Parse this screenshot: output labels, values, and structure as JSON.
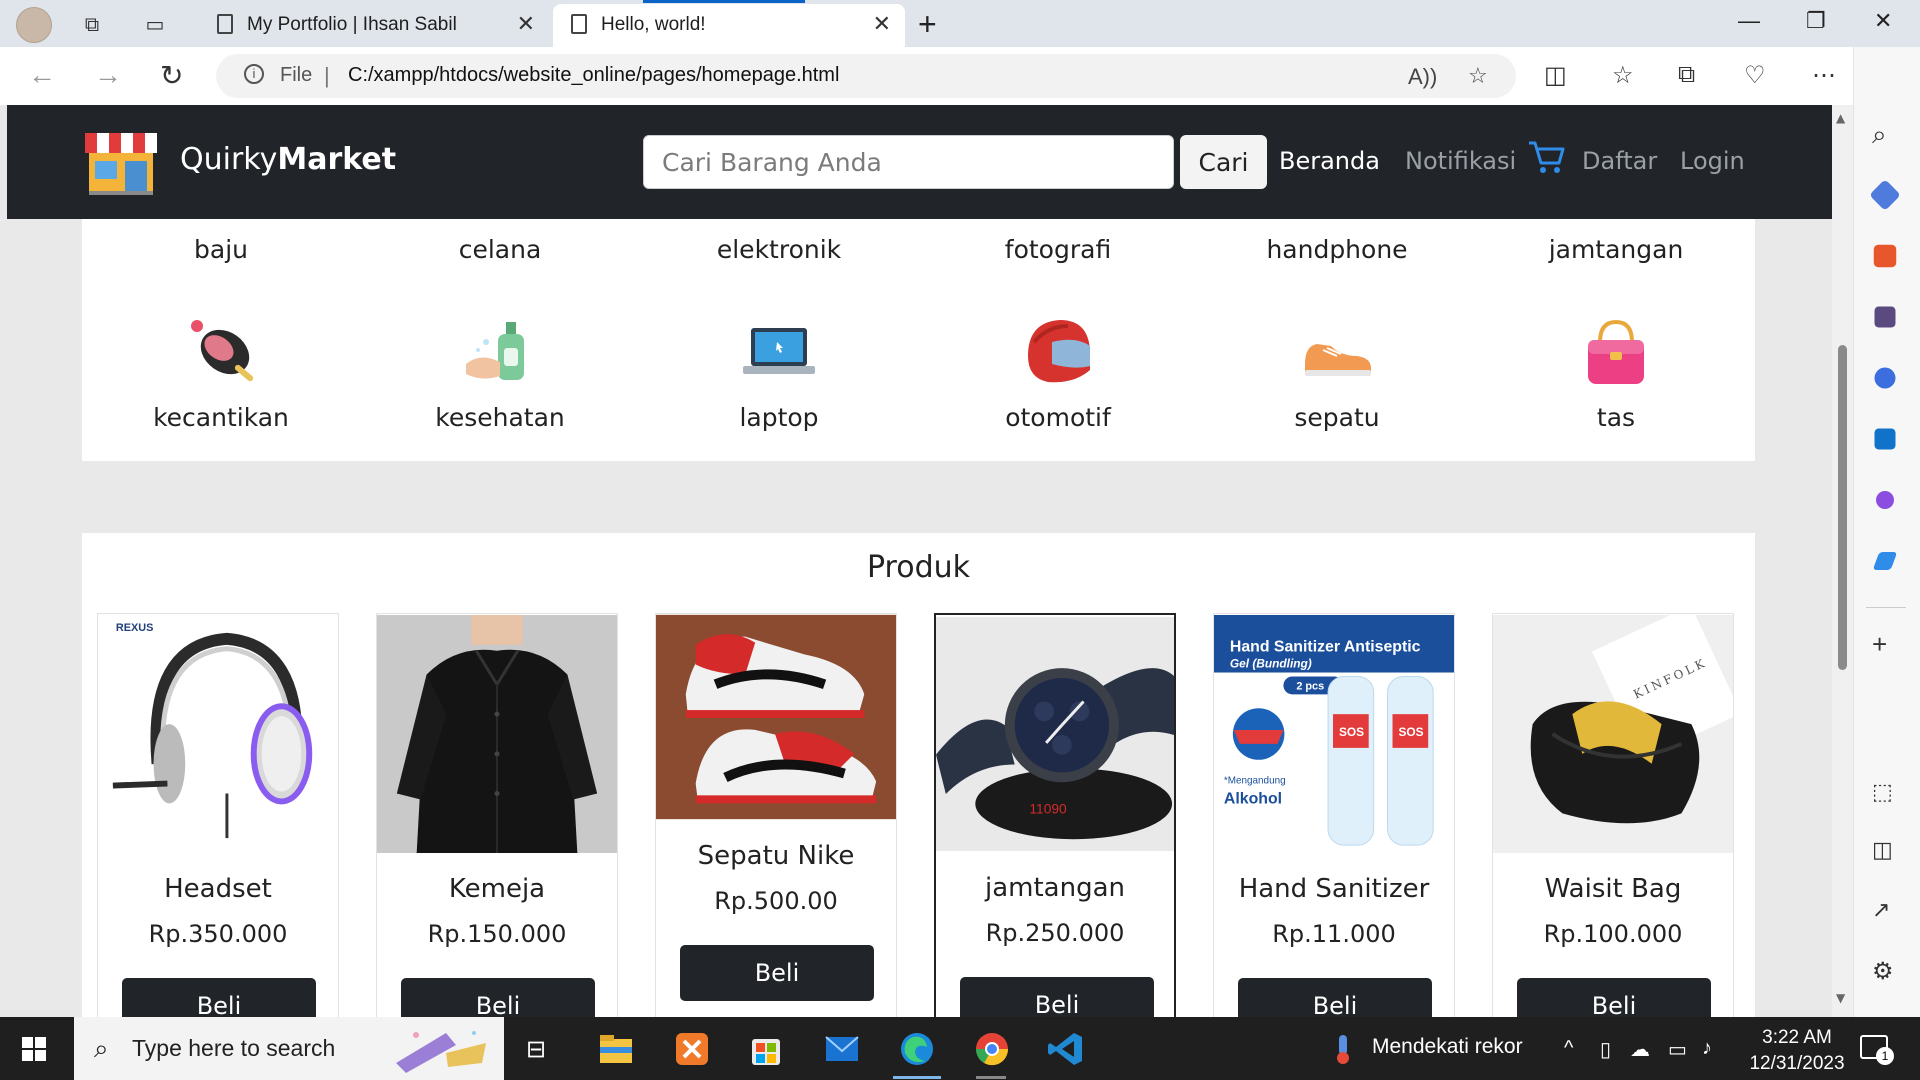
{
  "browser": {
    "tabs": [
      {
        "title": "My Portfolio | Ihsan Sabil",
        "active": false
      },
      {
        "title": "Hello, world!",
        "active": true
      }
    ],
    "address": {
      "scheme_label": "File",
      "url": "C:/xampp/htdocs/website_online/pages/homepage.html"
    },
    "accent_color": "#0a64c8"
  },
  "navbar": {
    "brand_prefix": "Quirky",
    "brand_bold": "Market",
    "search_placeholder": "Cari Barang Anda",
    "search_button": "Cari",
    "links": [
      "Beranda",
      "Notifikasi",
      "Daftar",
      "Login"
    ],
    "cart_icon": "cart-icon",
    "background": "#212529"
  },
  "categories": [
    {
      "label": "baju"
    },
    {
      "label": "celana"
    },
    {
      "label": "elektronik"
    },
    {
      "label": "fotografi"
    },
    {
      "label": "handphone"
    },
    {
      "label": "jamtangan"
    },
    {
      "label": "kecantikan",
      "icon": "makeup-icon"
    },
    {
      "label": "kesehatan",
      "icon": "hand-sanitizer-icon"
    },
    {
      "label": "laptop",
      "icon": "laptop-icon"
    },
    {
      "label": "otomotif",
      "icon": "helmet-icon"
    },
    {
      "label": "sepatu",
      "icon": "shoe-icon"
    },
    {
      "label": "tas",
      "icon": "bag-icon"
    }
  ],
  "products": {
    "heading": "Produk",
    "buy_label": "Beli",
    "items": [
      {
        "name": "Headset",
        "price": "Rp.350.000",
        "image": "headset-image",
        "image_text": "REXUS"
      },
      {
        "name": "Kemeja",
        "price": "Rp.150.000",
        "image": "shirt-image"
      },
      {
        "name": "Sepatu Nike",
        "price": "Rp.500.00",
        "image": "sneaker-image"
      },
      {
        "name": "jamtangan",
        "price": "Rp.250.000",
        "image": "watch-image",
        "image_text": "11090"
      },
      {
        "name": "Hand Sanitizer",
        "price": "Rp.11.000",
        "image": "sanitizer-image",
        "image_text": "Hand Sanitizer Antiseptic",
        "image_subtext": "Gel (Bundling)",
        "image_badge": "2 pcs",
        "image_brand": "SOS",
        "image_note": "*Mengandung",
        "image_note_bold": "Alkohol"
      },
      {
        "name": "Waisit Bag",
        "price": "Rp.100.000",
        "image": "waist-bag-image",
        "image_text": "KINFOLK"
      }
    ]
  },
  "taskbar": {
    "search_placeholder": "Type here to search",
    "weather_text": "Mendekati rekor",
    "time": "3:22 AM",
    "date": "12/31/2023",
    "notification_count": "1"
  }
}
